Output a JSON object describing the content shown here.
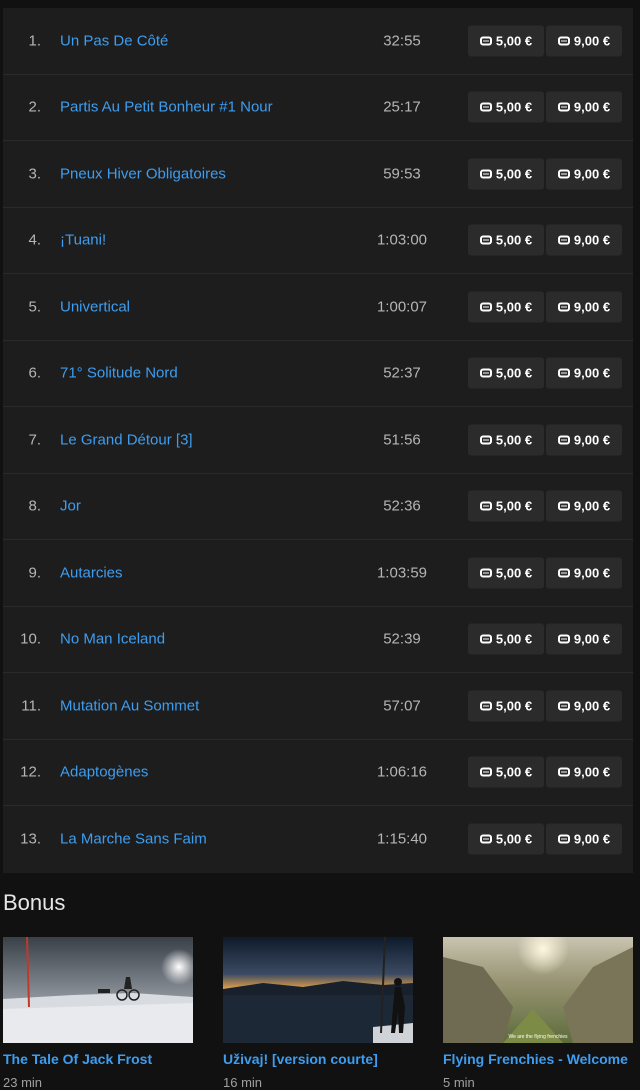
{
  "episodes": [
    {
      "num": "1.",
      "title": "Un Pas De Côté",
      "duration": "32:55"
    },
    {
      "num": "2.",
      "title": "Partis Au Petit Bonheur #1 Nour",
      "duration": "25:17"
    },
    {
      "num": "3.",
      "title": "Pneux Hiver Obligatoires",
      "duration": "59:53"
    },
    {
      "num": "4.",
      "title": "¡Tuani!",
      "duration": "1:03:00"
    },
    {
      "num": "5.",
      "title": "Univertical",
      "duration": "1:00:07"
    },
    {
      "num": "6.",
      "title": "71° Solitude Nord",
      "duration": "52:37"
    },
    {
      "num": "7.",
      "title": "Le Grand Détour [3]",
      "duration": "51:56"
    },
    {
      "num": "8.",
      "title": "Jor",
      "duration": "52:36"
    },
    {
      "num": "9.",
      "title": "Autarcies",
      "duration": "1:03:59"
    },
    {
      "num": "10.",
      "title": "No Man Iceland",
      "duration": "52:39"
    },
    {
      "num": "11.",
      "title": "Mutation Au Sommet",
      "duration": "57:07"
    },
    {
      "num": "12.",
      "title": "Adaptogènes",
      "duration": "1:06:16"
    },
    {
      "num": "13.",
      "title": "La Marche Sans Faim",
      "duration": "1:15:40"
    }
  ],
  "prices": {
    "rent": "5,00 €",
    "buy": "9,00 €"
  },
  "bonus": {
    "heading": "Bonus",
    "items": [
      {
        "title": "The Tale Of Jack Frost",
        "length": "23 min"
      },
      {
        "title": "Uživaj! [version courte]",
        "length": "16 min"
      },
      {
        "title": "Flying Frenchies - Welcome",
        "length": "5 min",
        "caption": "We are the flying frenchies"
      }
    ]
  },
  "colors": {
    "link": "#3d9df0",
    "panel": "#1d1d1d",
    "background": "#111111",
    "button": "#2b2b2b"
  },
  "icons": {
    "price_button": "monitor-icon"
  }
}
